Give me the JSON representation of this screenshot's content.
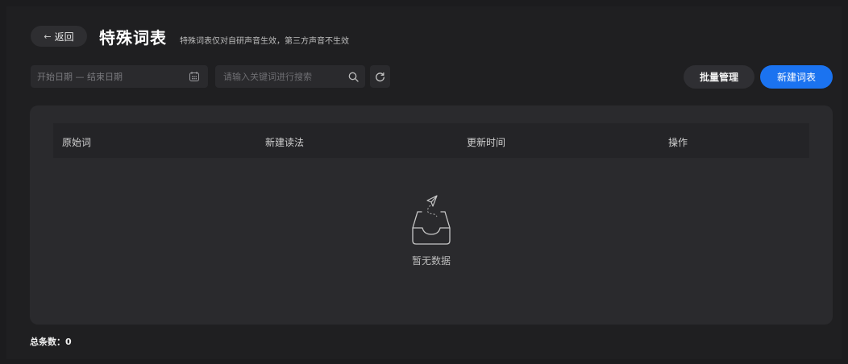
{
  "header": {
    "back_label": "返回",
    "title": "特殊词表",
    "subtitle": "特殊词表仅对自研声音生效，第三方声音不生效"
  },
  "filters": {
    "date_placeholder": "开始日期 — 结束日期",
    "search_placeholder": "请输入关键词进行搜索"
  },
  "actions": {
    "batch_label": "批量管理",
    "new_label": "新建词表"
  },
  "table": {
    "columns": [
      "原始词",
      "新建读法",
      "更新时间",
      "操作"
    ],
    "rows": [],
    "empty_text": "暂无数据"
  },
  "footer": {
    "total_label": "总条数：",
    "total_value": "0"
  },
  "colors": {
    "background": "#1c1c1e",
    "panel": "#2a2a2d",
    "accent": "#1b73f0"
  }
}
